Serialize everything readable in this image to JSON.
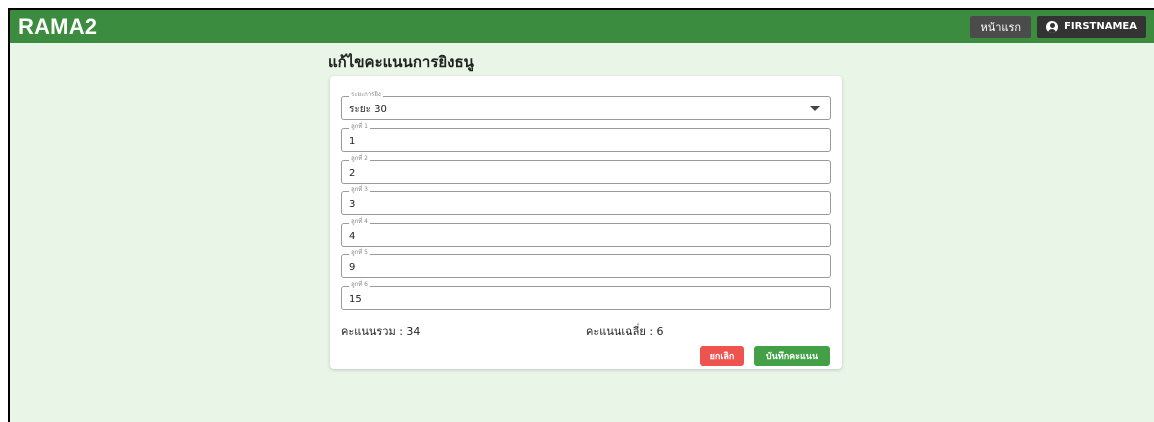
{
  "app": {
    "title": "RAMA2"
  },
  "nav": {
    "home_label": "หน้าแรก",
    "user_label": "FIRSTNAMEA"
  },
  "page": {
    "title": "แก้ไขคะแนนการยิงธนู"
  },
  "form": {
    "distance": {
      "label": "ระยะการยิง",
      "value": "ระยะ 30"
    },
    "arrows": [
      {
        "label": "ลูกที่ 1",
        "value": "1"
      },
      {
        "label": "ลูกที่ 2",
        "value": "2"
      },
      {
        "label": "ลูกที่ 3",
        "value": "3"
      },
      {
        "label": "ลูกที่ 4",
        "value": "4"
      },
      {
        "label": "ลูกที่ 5",
        "value": "9"
      },
      {
        "label": "ลูกที่ 6",
        "value": "15"
      }
    ],
    "total_text": "คะแนนรวม : 34",
    "average_text": "คะแนนเฉลี่ย : 6",
    "cancel_label": "ยกเลิก",
    "save_label": "บันทึกคะแนน"
  },
  "colors": {
    "appbar": "#3b8c3e",
    "background": "#e8f5e7",
    "cancel": "#ef5350",
    "save": "#43a047",
    "nav_button": "#4b4b4b"
  },
  "icons": {
    "user": "account-circle-icon",
    "dropdown": "caret-down-icon"
  }
}
